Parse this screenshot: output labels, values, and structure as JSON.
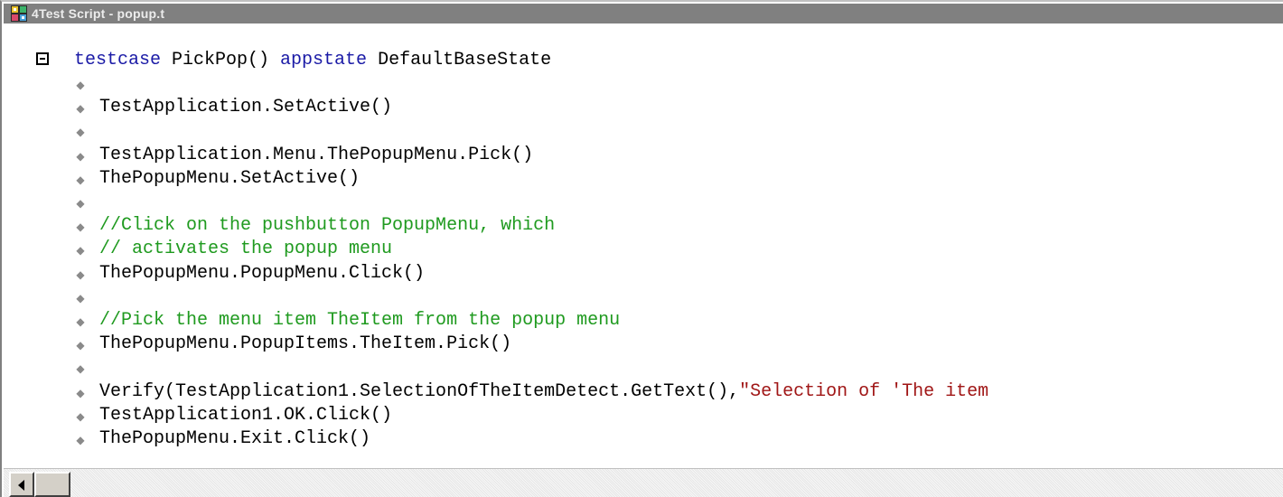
{
  "window": {
    "title": "4Test Script - popup.t",
    "icon": "4test-app-icon"
  },
  "colors": {
    "keyword": "#1a1aa6",
    "comment": "#1f9a1f",
    "string": "#a01616",
    "titlebar": "#808080"
  },
  "code": {
    "header": {
      "kw1": "testcase",
      "name": " PickPop() ",
      "kw2": "appstate",
      "state": " DefaultBaseState"
    },
    "lines": [
      {
        "type": "blank",
        "text": ""
      },
      {
        "type": "code",
        "text": "TestApplication.SetActive()"
      },
      {
        "type": "blank",
        "text": ""
      },
      {
        "type": "code",
        "text": "TestApplication.Menu.ThePopupMenu.Pick()"
      },
      {
        "type": "code",
        "text": "ThePopupMenu.SetActive()"
      },
      {
        "type": "blank",
        "text": ""
      },
      {
        "type": "comment",
        "text": "//Click on the pushbutton PopupMenu, which"
      },
      {
        "type": "comment",
        "text": "// activates the popup menu"
      },
      {
        "type": "code",
        "text": "ThePopupMenu.PopupMenu.Click()"
      },
      {
        "type": "blank",
        "text": ""
      },
      {
        "type": "comment",
        "text": "//Pick the menu item TheItem from the popup menu"
      },
      {
        "type": "code",
        "text": "ThePopupMenu.PopupItems.TheItem.Pick()"
      },
      {
        "type": "blank",
        "text": ""
      },
      {
        "type": "mixed",
        "text": "Verify(TestApplication1.SelectionOfTheItemDetect.GetText(),",
        "string": "\"Selection of 'The item"
      },
      {
        "type": "code",
        "text": "TestApplication1.OK.Click()"
      },
      {
        "type": "code",
        "text": "ThePopupMenu.Exit.Click()"
      }
    ]
  }
}
